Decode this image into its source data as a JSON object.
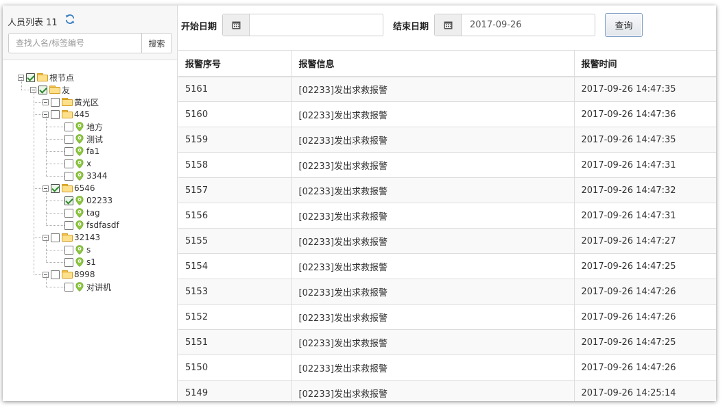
{
  "left_panel": {
    "title": "人员列表 11",
    "search_placeholder": "查找人名/标签编号",
    "search_button": "搜索"
  },
  "tree": {
    "root": {
      "label": "根节点",
      "checked": true
    },
    "group": {
      "label": "友",
      "checked": true
    },
    "folders": [
      {
        "label": "黄光区",
        "checked": false,
        "children": []
      },
      {
        "label": "445",
        "checked": false,
        "children": [
          {
            "label": "地方",
            "checked": false
          },
          {
            "label": "测试",
            "checked": false
          },
          {
            "label": "fa1",
            "checked": false
          },
          {
            "label": "x",
            "checked": false
          },
          {
            "label": "3344",
            "checked": false
          }
        ]
      },
      {
        "label": "6546",
        "checked": true,
        "children": [
          {
            "label": "02233",
            "checked": true
          },
          {
            "label": "tag",
            "checked": false
          },
          {
            "label": "fsdfasdf",
            "checked": false
          }
        ]
      },
      {
        "label": "32143",
        "checked": false,
        "children": [
          {
            "label": "s",
            "checked": false
          },
          {
            "label": "s1",
            "checked": false
          }
        ]
      },
      {
        "label": "8998",
        "checked": false,
        "children": [
          {
            "label": "对讲机",
            "checked": false
          }
        ]
      }
    ]
  },
  "filter": {
    "start_label": "开始日期",
    "start_value": "",
    "end_label": "结束日期",
    "end_value": "2017-09-26",
    "query_button": "查询"
  },
  "table": {
    "headers": [
      "报警序号",
      "报警信息",
      "报警时间"
    ],
    "rows": [
      [
        "5161",
        "[02233]发出求救报警",
        "2017-09-26 14:47:35"
      ],
      [
        "5160",
        "[02233]发出求救报警",
        "2017-09-26 14:47:36"
      ],
      [
        "5159",
        "[02233]发出求救报警",
        "2017-09-26 14:47:35"
      ],
      [
        "5158",
        "[02233]发出求救报警",
        "2017-09-26 14:47:31"
      ],
      [
        "5157",
        "[02233]发出求救报警",
        "2017-09-26 14:47:32"
      ],
      [
        "5156",
        "[02233]发出求救报警",
        "2017-09-26 14:47:31"
      ],
      [
        "5155",
        "[02233]发出求救报警",
        "2017-09-26 14:47:27"
      ],
      [
        "5154",
        "[02233]发出求救报警",
        "2017-09-26 14:47:25"
      ],
      [
        "5153",
        "[02233]发出求救报警",
        "2017-09-26 14:47:26"
      ],
      [
        "5152",
        "[02233]发出求救报警",
        "2017-09-26 14:47:26"
      ],
      [
        "5151",
        "[02233]发出求救报警",
        "2017-09-26 14:47:25"
      ],
      [
        "5150",
        "[02233]发出求救报警",
        "2017-09-26 14:47:26"
      ],
      [
        "5149",
        "[02233]发出求救报警",
        "2017-09-26 14:25:14"
      ]
    ]
  },
  "icons": {
    "refresh": "refresh-icon",
    "calendar": "calendar-icon",
    "folder": "folder-icon",
    "person": "location-pin-icon"
  },
  "colors": {
    "refresh": "#3a7fc1",
    "pin": "#8cc63f",
    "folder": "#fde08b",
    "check": "#2c8a2c"
  }
}
